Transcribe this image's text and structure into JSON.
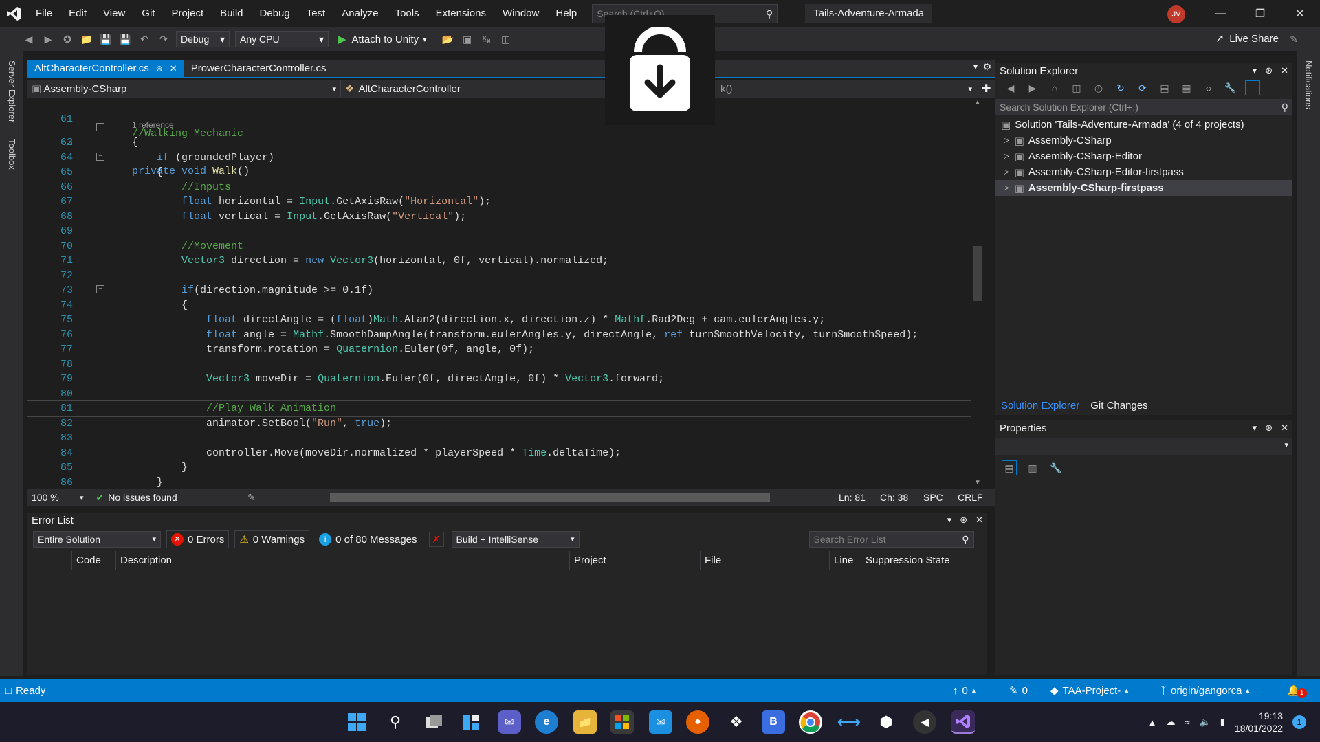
{
  "titlebar": {
    "menu": [
      "File",
      "Edit",
      "View",
      "Git",
      "Project",
      "Build",
      "Debug",
      "Test",
      "Analyze",
      "Tools",
      "Extensions",
      "Window",
      "Help"
    ],
    "search_placeholder": "Search (Ctrl+Q)",
    "solution_name": "Tails-Adventure-Armada",
    "avatar_initials": "JV"
  },
  "toolbar": {
    "config": "Debug",
    "platform": "Any CPU",
    "attach_label": "Attach to Unity",
    "live_share": "Live Share"
  },
  "side_strips": {
    "server_explorer": "Server Explorer",
    "toolbox": "Toolbox",
    "notifications": "Notifications"
  },
  "editor": {
    "tabs": [
      {
        "label": "AltCharacterController.cs",
        "active": true
      },
      {
        "label": "ProwerCharacterController.cs",
        "active": false
      }
    ],
    "nav_project": "Assembly-CSharp",
    "nav_class": "AltCharacterController",
    "nav_member_partial": "k()",
    "zoom": "100 %",
    "issues": "No issues found",
    "ln": "Ln: 81",
    "ch": "Ch: 38",
    "spc": "SPC",
    "crlf": "CRLF",
    "reference_hint": "1 reference",
    "lines": [
      {
        "n": "61",
        "text": "//Walking Mechanic"
      },
      {
        "n": "62",
        "text": "private void Walk()"
      },
      {
        "n": "63",
        "text": "{"
      },
      {
        "n": "64",
        "text": "    if (groundedPlayer)"
      },
      {
        "n": "65",
        "text": "    {"
      },
      {
        "n": "66",
        "text": "        //Inputs"
      },
      {
        "n": "67",
        "text": "        float horizontal = Input.GetAxisRaw(\"Horizontal\");"
      },
      {
        "n": "68",
        "text": "        float vertical = Input.GetAxisRaw(\"Vertical\");"
      },
      {
        "n": "69",
        "text": ""
      },
      {
        "n": "70",
        "text": "        //Movement"
      },
      {
        "n": "71",
        "text": "        Vector3 direction = new Vector3(horizontal, 0f, vertical).normalized;"
      },
      {
        "n": "72",
        "text": ""
      },
      {
        "n": "73",
        "text": "        if(direction.magnitude >= 0.1f)"
      },
      {
        "n": "74",
        "text": "        {"
      },
      {
        "n": "75",
        "text": "            float directAngle = (float)Math.Atan2(direction.x, direction.z) * Mathf.Rad2Deg + cam.eulerAngles.y;"
      },
      {
        "n": "76",
        "text": "            float angle = Mathf.SmoothDampAngle(transform.eulerAngles.y, directAngle, ref turnSmoothVelocity, turnSmoothSpeed);"
      },
      {
        "n": "77",
        "text": "            transform.rotation = Quaternion.Euler(0f, angle, 0f);"
      },
      {
        "n": "78",
        "text": ""
      },
      {
        "n": "79",
        "text": "            Vector3 moveDir = Quaternion.Euler(0f, directAngle, 0f) * Vector3.forward;"
      },
      {
        "n": "80",
        "text": ""
      },
      {
        "n": "81",
        "text": "            //Play Walk Animation"
      },
      {
        "n": "82",
        "text": "            animator.SetBool(\"Run\", true);"
      },
      {
        "n": "83",
        "text": ""
      },
      {
        "n": "84",
        "text": "            controller.Move(moveDir.normalized * playerSpeed * Time.deltaTime);"
      },
      {
        "n": "85",
        "text": "        }"
      },
      {
        "n": "86",
        "text": "    }"
      }
    ]
  },
  "solution_explorer": {
    "title": "Solution Explorer",
    "search_placeholder": "Search Solution Explorer (Ctrl+;)",
    "solution_label": "Solution 'Tails-Adventure-Armada' (4 of 4 projects)",
    "projects": [
      "Assembly-CSharp",
      "Assembly-CSharp-Editor",
      "Assembly-CSharp-Editor-firstpass",
      "Assembly-CSharp-firstpass"
    ],
    "tabs": [
      "Solution Explorer",
      "Git Changes"
    ]
  },
  "properties": {
    "title": "Properties"
  },
  "error_list": {
    "title": "Error List",
    "scope": "Entire Solution",
    "errors": "0 Errors",
    "warnings": "0 Warnings",
    "messages": "0 of 80 Messages",
    "build_filter": "Build + IntelliSense",
    "search_placeholder": "Search Error List",
    "columns": [
      "Code",
      "Description",
      "Project",
      "File",
      "Line",
      "Suppression State"
    ]
  },
  "statusbar": {
    "ready": "Ready",
    "up_count": "0",
    "pencil_count": "0",
    "repo": "TAA-Project-",
    "branch": "origin/gangorca",
    "notif_count": "1"
  },
  "taskbar": {
    "time": "19:13",
    "date": "18/01/2022",
    "notif_count": "1"
  },
  "colors": {
    "accent": "#007acc",
    "keyword": "#569cd6",
    "comment": "#57a64a",
    "type": "#4ec9b0",
    "string": "#d69d85"
  }
}
